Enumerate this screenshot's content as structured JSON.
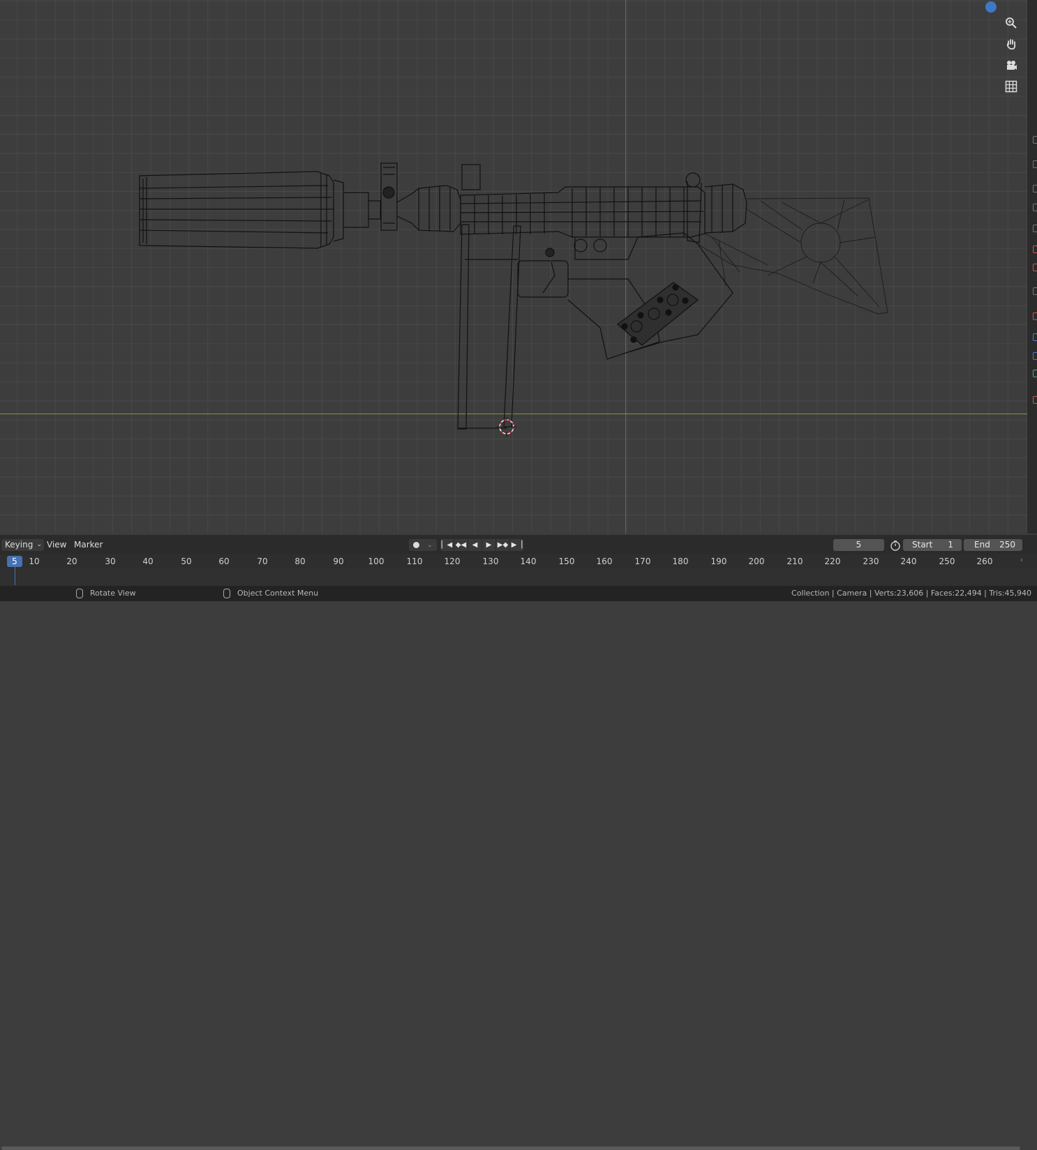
{
  "timeline": {
    "keying_label": "Keying",
    "view_label": "View",
    "marker_label": "Marker",
    "current_frame": "5",
    "start_label": "Start",
    "start_value": "1",
    "end_label": "End",
    "end_value": "250",
    "ruler_ticks": [
      "5",
      "10",
      "20",
      "30",
      "40",
      "50",
      "60",
      "70",
      "80",
      "90",
      "100",
      "110",
      "120",
      "130",
      "140",
      "150",
      "160",
      "170",
      "180",
      "190",
      "200",
      "210",
      "220",
      "230",
      "240",
      "250",
      "260"
    ]
  },
  "status_bar": {
    "left_hint": "Rotate View",
    "middle_hint": "Object Context Menu",
    "stats": "Collection | Camera | Verts:23,606 | Faces:22,494 | Tris:45,940"
  },
  "icons": {
    "zoom": "zoom-icon",
    "pan": "hand-icon",
    "camera": "camera-icon",
    "grid": "grid-icon"
  },
  "colors": {
    "viewport_bg": "#3d3d3d",
    "grid_line": "#484848",
    "y_axis": "#3b6fb2",
    "x_axis": "#7f9a3a",
    "accent": "#4772b3"
  }
}
